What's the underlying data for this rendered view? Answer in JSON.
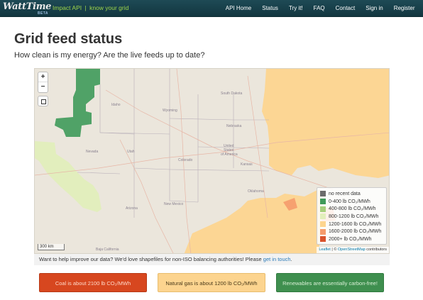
{
  "navbar": {
    "logo_text": "WattTime",
    "logo_badge": "BETA",
    "tagline_left": "Impact API",
    "tagline_sep": "|",
    "tagline_right": "know your grid",
    "links": [
      "API Home",
      "Status",
      "Try it!",
      "FAQ",
      "Contact",
      "Sign in",
      "Register"
    ]
  },
  "page": {
    "title": "Grid feed status",
    "subtitle": "How clean is my energy? Are the live feeds up to date?"
  },
  "map": {
    "zoom_in": "+",
    "zoom_out": "−",
    "scale_label": "300 km",
    "attribution": {
      "leaflet": "Leaflet",
      "mid": " | © ",
      "osm": "OpenStreetMap",
      "tail": " contributors"
    },
    "labels": {
      "south_dakota": "South Dakota",
      "wyoming": "Wyoming",
      "idaho": "Idaho",
      "nebraska": "Nebraska",
      "nevada": "Nevada",
      "utah": "Utah",
      "colorado": "Colorado",
      "kansas": "Kansas",
      "us_line1": "United",
      "us_line2": "States",
      "us_line3": "of America",
      "arizona": "Arizona",
      "new_mexico": "New Mexico",
      "oklahoma": "Oklahoma",
      "baja": "Baja California"
    },
    "colors": {
      "land": "#ebe6dc",
      "no_data": "#6b6b6b",
      "band_0_400": "#3f9a5a",
      "band_400_800": "#a7cf7d",
      "band_800_1200": "#e2eebb",
      "band_1200_1600": "#fdd58f",
      "band_1600_2000": "#f59b6b",
      "band_2000_plus": "#d9532c"
    },
    "legend": [
      {
        "label": "no recent data",
        "color": "#6b6b6b"
      },
      {
        "label": "0-400 lb CO₂/MWh",
        "color": "#3f9a5a"
      },
      {
        "label": "400-800 lb CO₂/MWh",
        "color": "#a7cf7d"
      },
      {
        "label": "800-1200 lb CO₂/MWh",
        "color": "#e2eebb"
      },
      {
        "label": "1200-1600 lb CO₂/MWh",
        "color": "#fdd58f"
      },
      {
        "label": "1600-2000 lb CO₂/MWh",
        "color": "#f59b6b"
      },
      {
        "label": "2000+ lb CO₂/MWh",
        "color": "#d9532c"
      }
    ]
  },
  "help": {
    "text": "Want to help improve our data? We'd love shapefiles for non-ISO balancing authorities! Please ",
    "link": "get in touch",
    "end": "."
  },
  "buttons": {
    "coal": "Coal is about 2100 lb CO₂/MWh",
    "gas": "Natural gas is about 1200 lb CO₂/MWh",
    "renewables": "Renewables are essentially carbon-free!"
  }
}
